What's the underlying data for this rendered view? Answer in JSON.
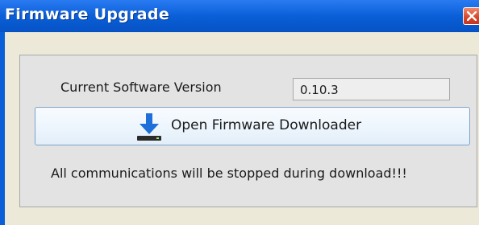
{
  "window": {
    "title": "Firmware Upgrade"
  },
  "version": {
    "label": "Current Software Version",
    "value": "0.10.3"
  },
  "downloader_button": {
    "label": "Open Firmware Downloader",
    "icon": "download-icon"
  },
  "notice": {
    "text": "All communications will be stopped during download!!!"
  },
  "colors": {
    "titlebar": "#0a5fd8",
    "close_button": "#d6462a",
    "panel_background": "#e3e3e3",
    "button_border": "#7ea3c9",
    "download_arrow": "#1e6fd9"
  }
}
